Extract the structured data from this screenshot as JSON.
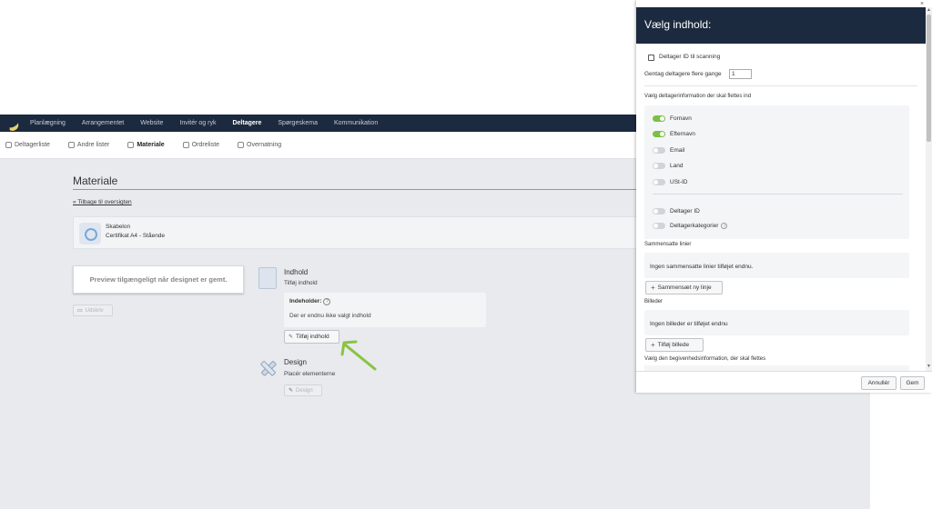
{
  "topnav": {
    "items": [
      "Planlægning",
      "Arrangementet",
      "Website",
      "Invitér og ryk",
      "Deltagere",
      "Spørgeskema",
      "Kommunikation"
    ],
    "active": "Deltagere"
  },
  "subnav": {
    "items": [
      "Deltagerliste",
      "Andre lister",
      "Materiale",
      "Ordreliste",
      "Overnatning"
    ],
    "active": "Materiale"
  },
  "page": {
    "title": "Materiale",
    "back_link": "« Tilbage til oversigten",
    "template": {
      "title": "Skabelon",
      "subtitle": "Certifikat A4 - Stående"
    },
    "preview": "Preview tilgængeligt når designet er gemt.",
    "print_button": "Udskriv",
    "content": {
      "title": "Indhold",
      "subtitle": "Tilføj indhold",
      "contains_label": "Indeholder:",
      "contains_empty": "Der er endnu ikke valgt indhold",
      "add_button": "Tilføj indhold"
    },
    "design": {
      "title": "Design",
      "subtitle": "Placér elementerne",
      "button": "Design"
    }
  },
  "panel": {
    "title": "Vælg indhold:",
    "close": "×",
    "scan_label": "Deltager ID til scanning",
    "repeat_label": "Gentag deltagere flere gange",
    "repeat_value": "1",
    "info_label": "Vælg deltagerinformation der skal flettes ind",
    "toggles": [
      {
        "label": "Fornavn",
        "on": true
      },
      {
        "label": "Efternavn",
        "on": true
      },
      {
        "label": "Email",
        "on": false
      },
      {
        "label": "Land",
        "on": false
      },
      {
        "label": "USt-ID",
        "on": false
      },
      {
        "label": "Deltager ID",
        "on": false
      },
      {
        "label": "Deltagerkategorier",
        "on": false
      }
    ],
    "combined_label": "Sammensatte linier",
    "combined_empty": "Ingen sammensatte linier tilføjet endnu.",
    "combine_button": "Sammensæt ny linje",
    "images_label": "Billeder",
    "images_empty": "Ingen billeder er tilføjet endnu",
    "add_image_button": "Tilføj billede",
    "event_label": "Vælg den begivenhedsinformation, der skal flettes",
    "cancel_button": "Annullér",
    "save_button": "Gem"
  },
  "colors": {
    "nav": "#1b2a3e",
    "toggle_on": "#7bc043",
    "arrow": "#8ac33f"
  }
}
